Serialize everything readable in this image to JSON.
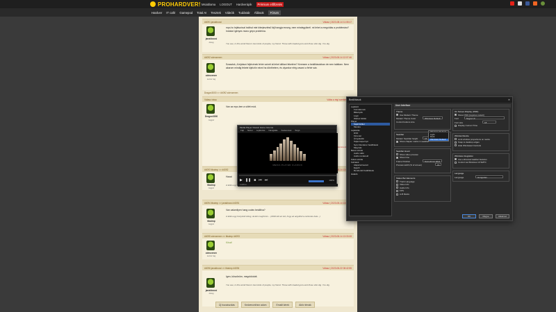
{
  "site": {
    "logo_text": "PROHARDVER!",
    "top_links": [
      "Msiablama",
      "LOGOUT",
      "Hardverápik",
      "Prémium előfizetés"
    ],
    "nav": [
      "Hardver",
      "IT café",
      "Gamepod",
      "Total AI",
      "Tesztek",
      "Videók",
      "Tudástár",
      "Állások",
      "Fórum"
    ]
  },
  "posts": [
    {
      "head_left": "#4091 janakbocsi",
      "head_right": "Válasz | 2023-08-14 11:08:17",
      "user": "janakbocsi",
      "rank": "őstag",
      "text": "mpc-hc lejátszóval indítsd mte kiterjesztésű fájl hangja recseg, nem mindegyiknél. mi lehet a megoldás a problémára? Indokot igényes mono gépn probléma.",
      "sig": "You see, in this world there's two kinds of people, my friend. Those with loaded guns and those who dig. You dig."
    },
    {
      "head_left": "#4092 zdenzenen",
      "head_right": "Válasz | 2023-08-14 12:07:46",
      "user": "zdenzenen",
      "rank": "senior tag",
      "text": "Szasztok, A lejátszó fejlécének fehér színét át lehet állítani feketére? Keresem a beállításokban de nem találtam. Nem akarom mindig fekete kijelzőn nézni ha dönthetem, és olyankor elég zavaró a fehér sáv.",
      "sig": ""
    },
    {
      "quote": "Dragon3000 >> #4092 zdenzenen",
      "head_left": "Válasz írása",
      "head_right": "Válás a régi szerkesztőre",
      "user": "Dragon3000",
      "rank": "nagyúr",
      "text": "Van az mpc-ben a sötét mód.",
      "sig": "",
      "comments_link": "Ujabb kommentekért"
    },
    {
      "head_left": "#4093 tibaimp >> #4092",
      "head_right": "Válasz | 2023-08-14 13:28:54",
      "user": "tibaimp",
      "rank": "nagyúr",
      "text": "Hazai",
      "sig": "A teliós egy bonyolult dolog..."
    },
    {
      "head_left": "#4094 tibaimp >> janakbocsi #4091",
      "head_right": "Válasz | 2023-08-14 13:32:27",
      "user": "tibaimp",
      "rank": "nagyúr",
      "text": "Van valamilyen hang codec beállítva?",
      "sig": "A teliós egy bonyolult dolog, de Ein meghírom... (2016-ból az tud, hogy az angolból a rezzenés bele...)"
    },
    {
      "head_left": "#4095 zdenzenen >> tibaimp #4093",
      "head_right": "Válasz | 2023-08-14 13:33:08",
      "user": "zdenzenen",
      "rank": "senior tag",
      "text": "Köszi!",
      "sig": ""
    },
    {
      "head_left": "#4096 janakbocsi >> tibaimp #4094",
      "head_right": "Válasz | 2023-08-22 08:42:55",
      "user": "janakbocsi",
      "rank": "őstag",
      "text": "Igen, köszönöm, megoldódott.",
      "sig": "You see, in this world there's two kinds of people, my friend. Those with loaded guns and those who dig. You dig."
    }
  ],
  "bottom_buttons": [
    "Új hozzászólás",
    "Kedvencekhez adom",
    "Emailt kérek",
    "Aktív témák"
  ],
  "player": {
    "title": "Media Player Classic Home Cinema",
    "menu": [
      "Fájl",
      "Nézet",
      "Lejátszás",
      "Navigálás",
      "Kedvencek",
      "Súgó"
    ],
    "logo_text": "MEDIA PLAYER CLASSIC",
    "volume": "100%",
    "status": "Leállítva"
  },
  "options": {
    "title": "Beállítások",
    "tree": [
      "Lejátszó",
      "Formátumok",
      "Billentyűk",
      "Logó",
      "Webes felület",
      "Player",
      "Saját felület",
      "Mentés",
      "Lejátszás",
      "DVD",
      "Kimenet",
      "Árnyékolók",
      "Teljes képernyő",
      "Sync Renderer beállítások",
      "Mégmás",
      "Belső szűrők",
      "Audio váltó",
      "Audio renderelő",
      "Külső szűrők",
      "Feliratok",
      "Alapértelmezett",
      "Egyéb",
      "Renderelő beállítások",
      "Haladó"
    ],
    "tree_selected": "Saját felület",
    "section": "User Interface",
    "theme_group": "Theme",
    "use_modern_theme": "Use Modern Theme",
    "modern_theme_color": "Modern Theme Color",
    "theme_value": "Windows Default",
    "theme_options": [
      "Windows Default",
      "Light",
      "Dark",
      "Windows Default"
    ],
    "control_buttons_size": "Control buttons size",
    "seekbar_group": "Seekbar",
    "modern_seekbar_height": "Modern Seekbar height",
    "seekbar_height_value": "16",
    "show_chapter_marks": "Show chapter marks in seekbar",
    "seekbar_hover": "Seekbar Hover",
    "show_video_preview": "Show video preview",
    "show_time": "Show time",
    "frame_position": "Frame Position",
    "frame_value": "Sometimes label",
    "preview_width": "Preview width (% of screen)",
    "preview_value": "15",
    "status_group": "Status Bar Elements",
    "track_language": "Track Language",
    "video_info": "Video Info",
    "audio_info": "Audio Info",
    "fps": "FPS",
    "ab_marks": "A-B Marks",
    "osd_group": "On Screen Display (OSD)",
    "show_osd": "Show OSD (requires restart)",
    "font_label": "Font",
    "font_value": "Segoe UI",
    "font_size_label": "Font size",
    "font_size_value": "18",
    "display_time": "Display Current Time",
    "window_resize": "Window Resize",
    "limit_window": "Limit window proportions on resize",
    "snap_desktop": "Snap to desktop edges",
    "hide_windowed": "Hide Windowed Controls",
    "windows_integration": "Windows integration",
    "use_enhanced": "Use enhanced taskbar features",
    "control_win": "Control via Windows 10 SMTC",
    "language_group": "Language",
    "language_label": "Language",
    "language_value": "Hungarian",
    "ok": "OK",
    "cancel": "Mégse",
    "apply": "Alkalmaz"
  }
}
